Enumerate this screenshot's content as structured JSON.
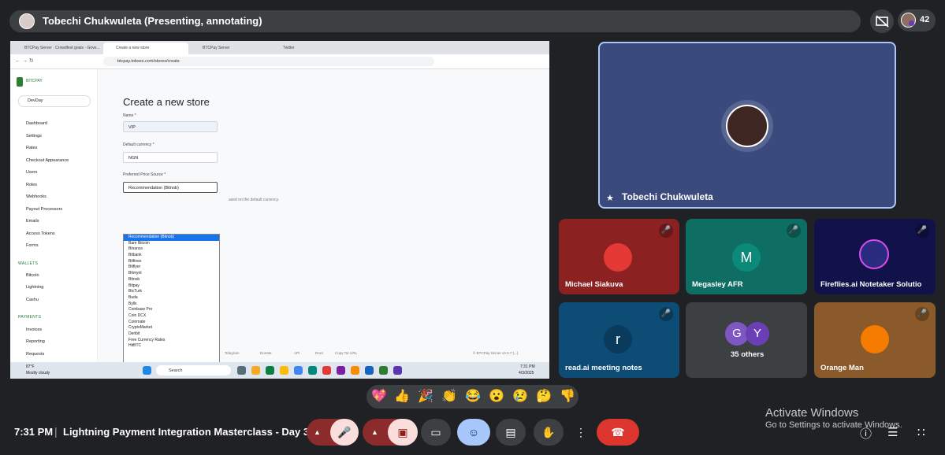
{
  "presenter": {
    "label": "Tobechi Chukwuleta (Presenting, annotating)",
    "participants_count": "42"
  },
  "shared_screen": {
    "browser": {
      "tabs": [
        "BTCPay Server · Crowdfest goals · Gove...",
        "Create a new store",
        "BTCPay Server",
        "Twitter"
      ],
      "url": "btcpay.tobses.com/stores/create"
    },
    "sidebar": {
      "brand": "BITCPAY",
      "store": "DevDay",
      "items": [
        "Dashboard",
        "Settings",
        "Rates",
        "Checkout Appearance",
        "Users",
        "Roles",
        "Webhooks",
        "Payout Processors",
        "Emails",
        "Access Tokens",
        "Forms"
      ],
      "wallets_header": "WALLETS",
      "wallets": [
        "Bitcoin",
        "Lightning",
        "Cashu"
      ],
      "payments_header": "PAYMENTS",
      "payments": [
        "Invoices",
        "Reporting",
        "Requests"
      ]
    },
    "form": {
      "title": "Create a new store",
      "name_label": "Name *",
      "name_value": "VIP",
      "currency_label": "Default currency *",
      "currency_value": "NGN",
      "price_label": "Preferred Price Source *",
      "price_value": "Recommendation (Bitnob)",
      "help_text": "ased on the default currency.",
      "options": [
        "Recommendation (Bitnob)",
        "Bare Bitcoin",
        "Binance",
        "Bitbank",
        "Bitfinex",
        "Bitflyer",
        "Bitmynt",
        "Bitnob",
        "Bitpay",
        "BtcTurk",
        "Buda",
        "Bylls",
        "Coinbase Pro",
        "Coin DCX",
        "Coinmate",
        "CryptoMarket",
        "Deribit",
        "Free Currency Rates",
        "HitBTC"
      ]
    },
    "footer": {
      "links": [
        "Telegram",
        "Donate",
        "API",
        "Docs",
        "Copy Tor URL"
      ],
      "version": "© BTCPay Server v2.0.7 (...)"
    },
    "taskbar": {
      "weather_temp": "87°F",
      "weather_desc": "Mostly cloudy",
      "search": "Search",
      "clock_time": "7:31 PM",
      "clock_date": "4/3/2025"
    }
  },
  "tiles": {
    "main": {
      "name": "Tobechi Chukwuleta"
    },
    "others": [
      {
        "name": "Michael Siakuva",
        "bg": "#8b2121"
      },
      {
        "name": "Megasley AFR",
        "initial": "M",
        "bg": "#0e6e63"
      },
      {
        "name": "Fireflies.ai Notetaker Solutio",
        "bg": "#12124a"
      },
      {
        "name": "read.ai meeting notes",
        "initial": "r",
        "bg": "#0d4c75"
      },
      {
        "name": "35 others",
        "initials": [
          "G",
          "Y"
        ],
        "bg": "#3c4043"
      },
      {
        "name": "Orange Man",
        "bg": "#8b5a2b"
      }
    ]
  },
  "reactions": [
    "💖",
    "👍",
    "🎉",
    "👏",
    "😂",
    "😮",
    "😢",
    "🤔",
    "👎"
  ],
  "bottom": {
    "time": "7:31 PM",
    "separator": "|",
    "title": "Lightning Payment Integration Masterclass - Day 3"
  },
  "activate": {
    "line1": "Activate Windows",
    "line2": "Go to Settings to activate Windows."
  },
  "colors": {
    "bg": "#202124",
    "end_call": "#ea4335",
    "muted": "#f9dedc",
    "accent": "#8ab4f8"
  }
}
